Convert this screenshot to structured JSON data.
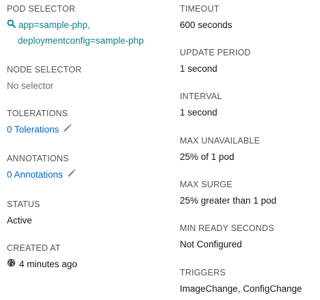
{
  "left": {
    "pod_selector": {
      "label": "POD SELECTOR",
      "line1": "app=sample-php,",
      "line2": "deploymentconfig=sample-php",
      "icon": "search-icon"
    },
    "node_selector": {
      "label": "NODE SELECTOR",
      "value": "No selector"
    },
    "tolerations": {
      "label": "TOLERATIONS",
      "value": "0 Tolerations",
      "icon": "pencil-icon"
    },
    "annotations": {
      "label": "ANNOTATIONS",
      "value": "0 Annotations",
      "icon": "pencil-icon"
    },
    "status": {
      "label": "STATUS",
      "value": "Active"
    },
    "created_at": {
      "label": "CREATED AT",
      "value": "4 minutes ago",
      "icon": "globe-icon"
    }
  },
  "right": {
    "timeout": {
      "label": "TIMEOUT",
      "value": "600 seconds"
    },
    "update_period": {
      "label": "UPDATE PERIOD",
      "value": "1 second"
    },
    "interval": {
      "label": "INTERVAL",
      "value": "1 second"
    },
    "max_unavailable": {
      "label": "MAX UNAVAILABLE",
      "value": "25% of 1 pod"
    },
    "max_surge": {
      "label": "MAX SURGE",
      "value": "25% greater than 1 pod"
    },
    "min_ready_seconds": {
      "label": "MIN READY SECONDS",
      "value": "Not Configured"
    },
    "triggers": {
      "label": "TRIGGERS",
      "value": "ImageChange, ConfigChange"
    }
  },
  "colors": {
    "label": "#4f5255",
    "text": "#151515",
    "muted": "#6a6e73",
    "link": "#0066cc",
    "selector": "#0f7f8a"
  }
}
